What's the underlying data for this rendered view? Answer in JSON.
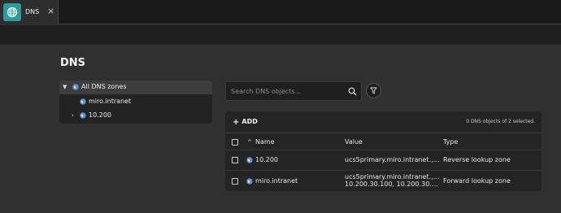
{
  "tab": {
    "label": "DNS",
    "close": "×"
  },
  "page": {
    "title": "DNS"
  },
  "tree": {
    "items": [
      {
        "label": "All DNS zones",
        "expanded": true,
        "selected": true
      },
      {
        "label": "miro.intranet"
      },
      {
        "label": "10.200",
        "expanded": false
      }
    ]
  },
  "search": {
    "placeholder": "Search DNS objects..."
  },
  "grid": {
    "add_label": "ADD",
    "selection_info": "0 DNS objects of 2 selected.",
    "columns": [
      "Name",
      "Value",
      "Type"
    ],
    "rows": [
      {
        "name": "10.200",
        "value_lines": [
          "ucs5primary.miro.intranet., ucs5r..."
        ],
        "type": "Reverse lookup zone"
      },
      {
        "name": "miro.intranet",
        "value_lines": [
          "ucs5primary.miro.intranet., ucs5r...",
          "10.200.30.100, 10.200.30.101, 10...."
        ],
        "type": "Forward lookup zone"
      }
    ]
  },
  "colors": {
    "accent": "#2a9d9a",
    "background": "#303030",
    "panel": "#242424"
  }
}
